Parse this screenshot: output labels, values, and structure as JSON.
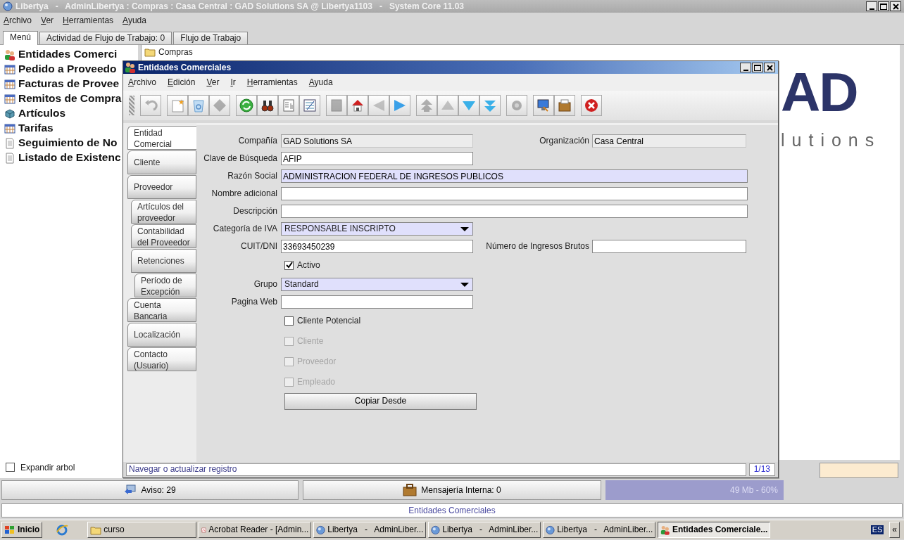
{
  "window": {
    "title": "Libertya   -   AdminLibertya : Compras : Casa Central : GAD Solutions SA @ Libertya1103   -   System Core 11.03"
  },
  "menu": [
    "Archivo",
    "Ver",
    "Herramientas",
    "Ayuda"
  ],
  "tabs": [
    {
      "label": "Menú",
      "selected": true
    },
    {
      "label": "Actividad de Flujo de Trabajo: 0",
      "selected": false
    },
    {
      "label": "Flujo de Trabajo",
      "selected": false
    }
  ],
  "tree": {
    "items": [
      {
        "label": "Entidades Comerci",
        "kind": "people"
      },
      {
        "label": "Pedido a Proveedo",
        "kind": "form"
      },
      {
        "label": "Facturas de Provee",
        "kind": "form"
      },
      {
        "label": "Remitos de Compra",
        "kind": "form"
      },
      {
        "label": "Artículos",
        "kind": "cube"
      },
      {
        "label": "Tarifas",
        "kind": "form"
      },
      {
        "label": "Seguimiento de No",
        "kind": "report"
      },
      {
        "label": "Listado de Existenc",
        "kind": "report"
      }
    ],
    "expand": {
      "label": "Expandir arbol",
      "checked": false
    }
  },
  "folder": {
    "label": "Compras"
  },
  "logo": {
    "top": "AD",
    "bottom": "lutions"
  },
  "dialog": {
    "title": "Entidades Comerciales",
    "menu": [
      "Archivo",
      "Edición",
      "Ver",
      "Ir",
      "Herramientas",
      "Ayuda"
    ],
    "toolbar": [
      [
        {
          "kind": "undo",
          "disabled": true
        }
      ],
      [
        {
          "kind": "new",
          "disabled": false
        },
        {
          "kind": "delete",
          "disabled": false
        },
        {
          "kind": "save",
          "disabled": true
        }
      ],
      [
        {
          "kind": "refresh",
          "disabled": false
        },
        {
          "kind": "find",
          "disabled": false
        },
        {
          "kind": "history",
          "disabled": false
        },
        {
          "kind": "grid",
          "disabled": false
        }
      ],
      [
        {
          "kind": "attachment",
          "disabled": true
        },
        {
          "kind": "home",
          "disabled": false
        },
        {
          "kind": "back",
          "disabled": true
        },
        {
          "kind": "forward",
          "disabled": false
        }
      ],
      [
        {
          "kind": "first",
          "disabled": true
        },
        {
          "kind": "previous",
          "disabled": true
        },
        {
          "kind": "next",
          "disabled": false
        },
        {
          "kind": "last",
          "disabled": false
        }
      ],
      [
        {
          "kind": "translate",
          "disabled": true
        }
      ],
      [
        {
          "kind": "export",
          "disabled": false
        },
        {
          "kind": "archive",
          "disabled": false
        }
      ],
      [
        {
          "kind": "close",
          "disabled": false
        }
      ]
    ],
    "side_tabs": [
      {
        "label": "Entidad Comercial",
        "selected": true
      },
      {
        "label": "Cliente",
        "selected": false
      },
      {
        "label": "Proveedor",
        "selected": false,
        "children": [
          {
            "label": "Artículos del proveedor",
            "selected": false
          },
          {
            "label": "Contabilidad del Proveedor",
            "selected": false
          },
          {
            "label": "Retenciones",
            "selected": false,
            "children": [
              {
                "label": "Período de Excepción",
                "selected": false
              }
            ]
          }
        ]
      },
      {
        "label": "Cuenta Bancaria",
        "selected": false
      },
      {
        "label": "Localización",
        "selected": false
      },
      {
        "label": "Contacto (Usuario)",
        "selected": false
      }
    ],
    "rows": [
      {
        "fields": [
          {
            "kind": "text",
            "label": "Compañía",
            "value": "GAD Solutions SA",
            "readonly": true,
            "mandatory": false,
            "wide": false
          },
          {
            "kind": "text",
            "label": "Organización",
            "value": "Casa Central",
            "readonly": true,
            "mandatory": false,
            "wide": false
          }
        ]
      },
      {
        "fields": [
          {
            "kind": "text",
            "label": "Clave de Búsqueda",
            "value": "AFIP",
            "readonly": false,
            "mandatory": false,
            "wide": false
          }
        ]
      },
      {
        "fields": [
          {
            "kind": "text",
            "label": "Razón Social",
            "value": "ADMINISTRACION FEDERAL DE INGRESOS PUBLICOS",
            "readonly": false,
            "mandatory": true,
            "wide": true
          }
        ]
      },
      {
        "fields": [
          {
            "kind": "text",
            "label": "Nombre adicional",
            "readonly": false,
            "mandatory": false,
            "wide": true
          }
        ]
      },
      {
        "fields": [
          {
            "kind": "text",
            "label": "Descripción",
            "readonly": false,
            "mandatory": false,
            "wide": true
          }
        ]
      },
      {
        "fields": [
          {
            "kind": "combo",
            "label": "Categoría de IVA",
            "value": "RESPONSABLE INSCRIPTO",
            "mandatory": true
          }
        ]
      },
      {
        "fields": [
          {
            "kind": "text",
            "label": "CUIT/DNI",
            "value": "33693450239",
            "readonly": false,
            "mandatory": false,
            "wide": false
          },
          {
            "kind": "text",
            "label": "Número de Ingresos Brutos",
            "readonly": false,
            "mandatory": false,
            "wide": false
          }
        ]
      },
      {
        "fields": [
          {
            "kind": "checkbox",
            "label": "Activo",
            "checked": true,
            "disabled": false
          }
        ]
      },
      {
        "fields": [
          {
            "kind": "combo",
            "label": "Grupo",
            "value": "Standard",
            "mandatory": true
          }
        ]
      },
      {
        "fields": [
          {
            "kind": "text",
            "label": "Pagina Web",
            "readonly": false,
            "mandatory": false,
            "wide": false
          }
        ]
      },
      {
        "fields": [
          {
            "kind": "checkbox",
            "label": "Cliente Potencial",
            "checked": false,
            "disabled": false
          }
        ]
      },
      {
        "fields": [
          {
            "kind": "checkbox",
            "label": "Cliente",
            "checked": false,
            "disabled": true
          }
        ]
      },
      {
        "fields": [
          {
            "kind": "checkbox",
            "label": "Proveedor",
            "checked": false,
            "disabled": true
          }
        ]
      },
      {
        "fields": [
          {
            "kind": "checkbox",
            "label": "Empleado",
            "checked": false,
            "disabled": true
          }
        ]
      },
      {
        "fields": [
          {
            "kind": "button",
            "label": "Copiar Desde"
          }
        ]
      }
    ],
    "status": "Navegar o actualizar registro",
    "record": "1/13"
  },
  "notices": {
    "alerts": "Aviso: 29",
    "messages": "Mensajería Interna: 0",
    "memory": "49 Mb - 60%"
  },
  "status_bar": "Entidades Comerciales",
  "taskbar": {
    "start": "Inicio",
    "tasks": [
      {
        "label": "curso",
        "kind": "folder",
        "selected": false
      },
      {
        "label": "Acrobat Reader - [Admin...",
        "kind": "pdf",
        "selected": false
      },
      {
        "label": "Libertya   -   AdminLiber...",
        "kind": "app",
        "selected": false
      },
      {
        "label": "Libertya   -   AdminLiber...",
        "kind": "app",
        "selected": false
      },
      {
        "label": "Libertya   -   AdminLiber...",
        "kind": "app",
        "selected": false
      },
      {
        "label": "Entidades Comerciale...",
        "kind": "people",
        "selected": true
      }
    ],
    "language": "ES",
    "chevron": "«"
  }
}
